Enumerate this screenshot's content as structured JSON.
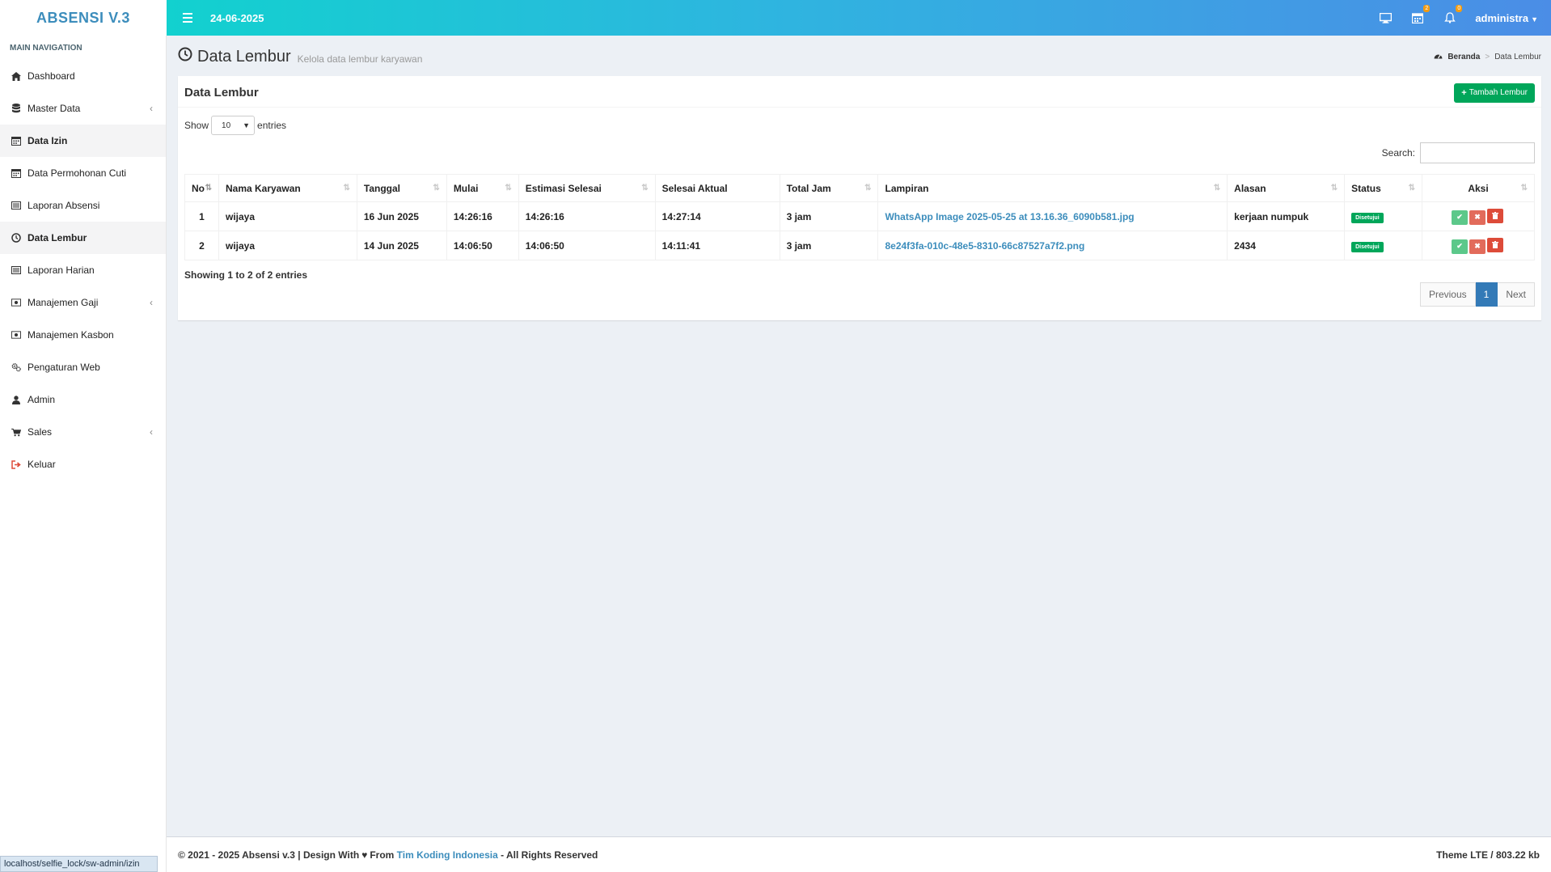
{
  "app": {
    "logo": "ABSENSI V.3"
  },
  "topbar": {
    "date": "24-06-2025",
    "calendar_badge": "2",
    "bell_badge": "0",
    "user": "administra"
  },
  "sidebar": {
    "header": "MAIN NAVIGATION",
    "items": [
      {
        "label": "Dashboard",
        "icon": "home-icon"
      },
      {
        "label": "Master Data",
        "icon": "database-icon",
        "chevron": true
      },
      {
        "label": "Data Izin",
        "icon": "calendar-icon"
      },
      {
        "label": "Data Permohonan Cuti",
        "icon": "calendar-icon"
      },
      {
        "label": "Laporan Absensi",
        "icon": "list-icon"
      },
      {
        "label": "Data Lembur",
        "icon": "clock-icon"
      },
      {
        "label": "Laporan Harian",
        "icon": "list-icon"
      },
      {
        "label": "Manajemen Gaji",
        "icon": "money-icon",
        "chevron": true
      },
      {
        "label": "Manajemen Kasbon",
        "icon": "money-icon"
      },
      {
        "label": "Pengaturan Web",
        "icon": "gears-icon"
      },
      {
        "label": "Admin",
        "icon": "user-icon"
      },
      {
        "label": "Sales",
        "icon": "cart-icon",
        "chevron": true
      },
      {
        "label": "Keluar",
        "icon": "sign-out-icon"
      }
    ]
  },
  "page": {
    "title": "Data Lembur",
    "subtitle": "Kelola data lembur karyawan"
  },
  "breadcrumb": {
    "home": "Beranda",
    "current": "Data Lembur"
  },
  "box": {
    "title": "Data Lembur",
    "add_button": "Tambah Lembur"
  },
  "table_controls": {
    "show": "Show",
    "entries_value": "10",
    "entries": "entries",
    "search_label": "Search:"
  },
  "table": {
    "columns": [
      "No",
      "Nama Karyawan",
      "Tanggal",
      "Mulai",
      "Estimasi Selesai",
      "Selesai Aktual",
      "Total Jam",
      "Lampiran",
      "Alasan",
      "Status",
      "Aksi"
    ],
    "rows": [
      {
        "no": "1",
        "nama": "wijaya",
        "tanggal": "16 Jun 2025",
        "mulai": "14:26:16",
        "estimasi": "14:26:16",
        "aktual": "14:27:14",
        "total": "3 jam",
        "lampiran": "WhatsApp Image 2025-05-25 at 13.16.36_6090b581.jpg",
        "alasan": "kerjaan numpuk",
        "status": "Disetujui"
      },
      {
        "no": "2",
        "nama": "wijaya",
        "tanggal": "14 Jun 2025",
        "mulai": "14:06:50",
        "estimasi": "14:06:50",
        "aktual": "14:11:41",
        "total": "3 jam",
        "lampiran": "8e24f3fa-010c-48e5-8310-66c87527a7f2.png",
        "alasan": "2434",
        "status": "Disetujui"
      }
    ]
  },
  "info": "Showing 1 to 2 of 2 entries",
  "pager": {
    "prev": "Previous",
    "page": "1",
    "next": "Next"
  },
  "footer": {
    "left_pre": "© 2021 - 2025 Absensi v.3 | Design With",
    "left_from": "From",
    "link": "Tim Koding Indonesia",
    "left_post": "- All Rights Reserved",
    "right": "Theme LTE / 803.22 kb"
  },
  "statusbar": "localhost/selfie_lock/sw-admin/izin"
}
